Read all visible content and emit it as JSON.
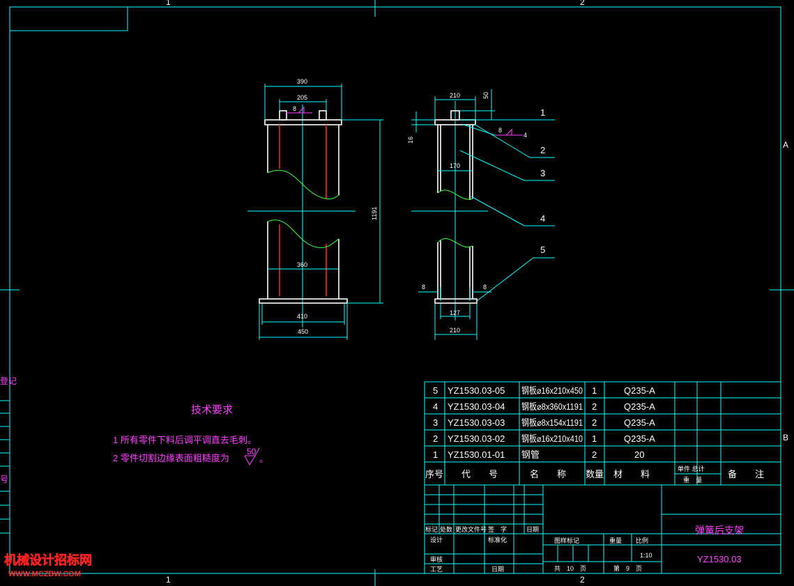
{
  "colors": {
    "background": "#000000",
    "frame": "#00ffff",
    "outline": "#ffffff",
    "hidden": "#ff2020",
    "break": "#40ff40",
    "text_accent": "#ff40ff"
  },
  "zone_labels": {
    "top_1": "1",
    "top_2": "2",
    "bottom_1": "1",
    "bottom_2": "2",
    "right_a": "A",
    "right_b": "B"
  },
  "left_margin": {
    "text1": "登记",
    "text2": "号"
  },
  "front_view": {
    "dims": {
      "top_width": "390",
      "hole_spacing": "205",
      "weld_size": "8",
      "height": "1191",
      "inner_width": "360",
      "plate_inner": "410",
      "plate_width": "450"
    }
  },
  "side_view": {
    "dims": {
      "top_width": "210",
      "tab_height": "50",
      "plate_thickness": "16",
      "weld_size": "8",
      "weld_qty": "4",
      "inner_width": "170",
      "bottom_weld_left": "8",
      "bottom_weld_right": "8",
      "hole_spacing": "127",
      "plate_width": "210"
    },
    "balloons": [
      "1",
      "2",
      "3",
      "4",
      "5"
    ]
  },
  "tech_requirements": {
    "title": "技术要求",
    "line1": "1 所有零件下料后调平调直去毛刺。",
    "line2": "2 零件切割边缘表面粗糙度为",
    "roughness": "50",
    "line2_end": "。"
  },
  "bom": {
    "rows": [
      {
        "seq": "5",
        "code": "YZ1530.03-05",
        "name": "钢板⌀16x210x450",
        "qty": "1",
        "material": "Q235-A"
      },
      {
        "seq": "4",
        "code": "YZ1530.03-04",
        "name": "钢板⌀8x360x1191",
        "qty": "2",
        "material": "Q235-A"
      },
      {
        "seq": "3",
        "code": "YZ1530.03-03",
        "name": "钢板⌀8x154x1191",
        "qty": "2",
        "material": "Q235-A"
      },
      {
        "seq": "2",
        "code": "YZ1530.03-02",
        "name": "钢板⌀16x210x410",
        "qty": "1",
        "material": "Q235-A"
      },
      {
        "seq": "1",
        "code": "YZ1530.01-01",
        "name": "钢管",
        "qty": "2",
        "material": "20"
      }
    ],
    "header": {
      "seq": "序号",
      "code": "代　　号",
      "name": "名　　称",
      "qty": "数量",
      "material": "材　　料",
      "unit_weight": "单件 总计",
      "weight": "重　量",
      "remark": "备　　注"
    }
  },
  "title_block": {
    "rev_labels": {
      "mark": "标记",
      "count": "处数",
      "doc": "更改文件号",
      "sign": "签　字",
      "date": "日期"
    },
    "roles": {
      "design": "设计",
      "standard": "标准化",
      "check": "审核",
      "process": "工艺",
      "date": "日期"
    },
    "stage_label": "图样标记",
    "weight_label": "重量",
    "scale_label": "比例",
    "scale": "1:10",
    "sheets_total": "共　10　页",
    "sheet_no": "第　9　页",
    "part_name": "弹簧后支架",
    "drawing_no": "YZ1530.03"
  },
  "watermark": {
    "line1": "机械设计招标网",
    "line2": "WWW.MCZBW.COM"
  }
}
